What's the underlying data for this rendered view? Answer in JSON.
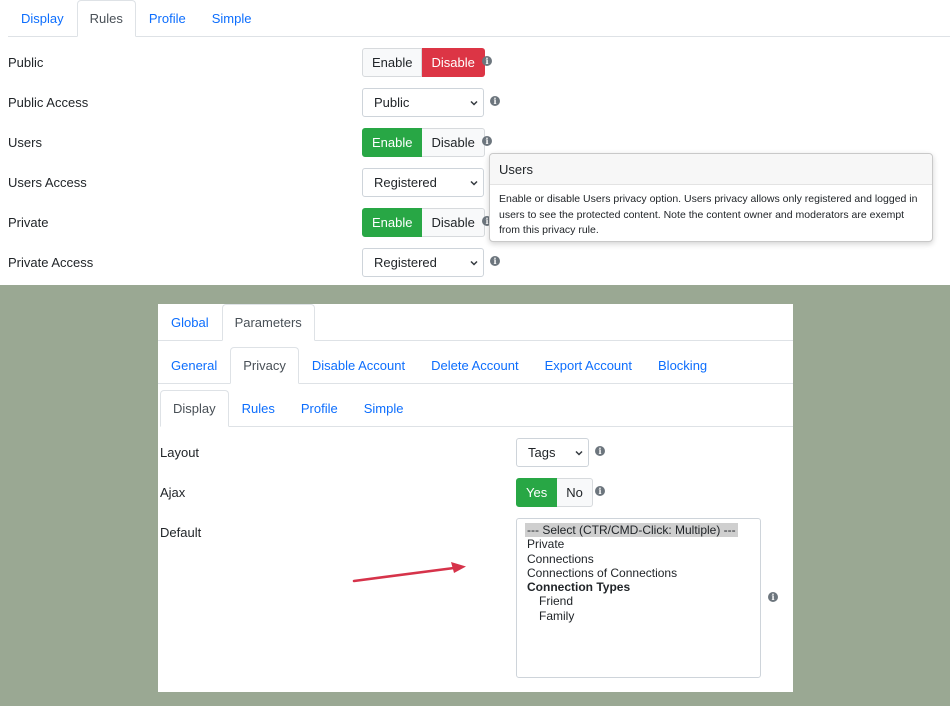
{
  "top_panel": {
    "tabs": [
      {
        "label": "Display",
        "active": false
      },
      {
        "label": "Rules",
        "active": true
      },
      {
        "label": "Profile",
        "active": false
      },
      {
        "label": "Simple",
        "active": false
      }
    ],
    "rows": {
      "public": {
        "label": "Public",
        "enable": "Enable",
        "disable": "Disable",
        "state": "disable"
      },
      "public_access": {
        "label": "Public Access",
        "value": "Public"
      },
      "users": {
        "label": "Users",
        "enable": "Enable",
        "disable": "Disable",
        "state": "enable"
      },
      "users_access": {
        "label": "Users Access",
        "value": "Registered"
      },
      "private": {
        "label": "Private",
        "enable": "Enable",
        "disable": "Disable",
        "state": "enable"
      },
      "private_access": {
        "label": "Private Access",
        "value": "Registered"
      }
    },
    "tooltip": {
      "title": "Users",
      "text": "Enable or disable Users privacy option. Users privacy allows only registered and logged in users to see the protected content. Note the content owner and moderators are exempt from this privacy rule."
    }
  },
  "bottom_panel": {
    "tabs_l1": [
      {
        "label": "Global",
        "active": false
      },
      {
        "label": "Parameters",
        "active": true
      }
    ],
    "tabs_l2": [
      {
        "label": "General",
        "active": false
      },
      {
        "label": "Privacy",
        "active": true
      },
      {
        "label": "Disable Account",
        "active": false
      },
      {
        "label": "Delete Account",
        "active": false
      },
      {
        "label": "Export Account",
        "active": false
      },
      {
        "label": "Blocking",
        "active": false
      }
    ],
    "tabs_l3": [
      {
        "label": "Display",
        "active": true
      },
      {
        "label": "Rules",
        "active": false
      },
      {
        "label": "Profile",
        "active": false
      },
      {
        "label": "Simple",
        "active": false
      }
    ],
    "layout": {
      "label": "Layout",
      "value": "Tags"
    },
    "ajax": {
      "label": "Ajax",
      "yes": "Yes",
      "no": "No",
      "state": "yes"
    },
    "default": {
      "label": "Default",
      "options": [
        {
          "text": "--- Select (CTR/CMD-Click: Multiple) ---",
          "kind": "selected"
        },
        {
          "text": "Private",
          "kind": "normal"
        },
        {
          "text": "Connections",
          "kind": "normal"
        },
        {
          "text": "Connections of Connections",
          "kind": "normal"
        },
        {
          "text": "Connection Types",
          "kind": "group"
        },
        {
          "text": "Friend",
          "kind": "child"
        },
        {
          "text": "Family",
          "kind": "child"
        }
      ]
    }
  },
  "colors": {
    "link": "#0d6efd",
    "danger": "#dc3545",
    "success": "#28a745",
    "backdrop": "#9aa893",
    "annotation_arrow": "#d6334a"
  },
  "icons": {
    "info": "info-icon",
    "select_chevron": "chevron-down-icon"
  }
}
